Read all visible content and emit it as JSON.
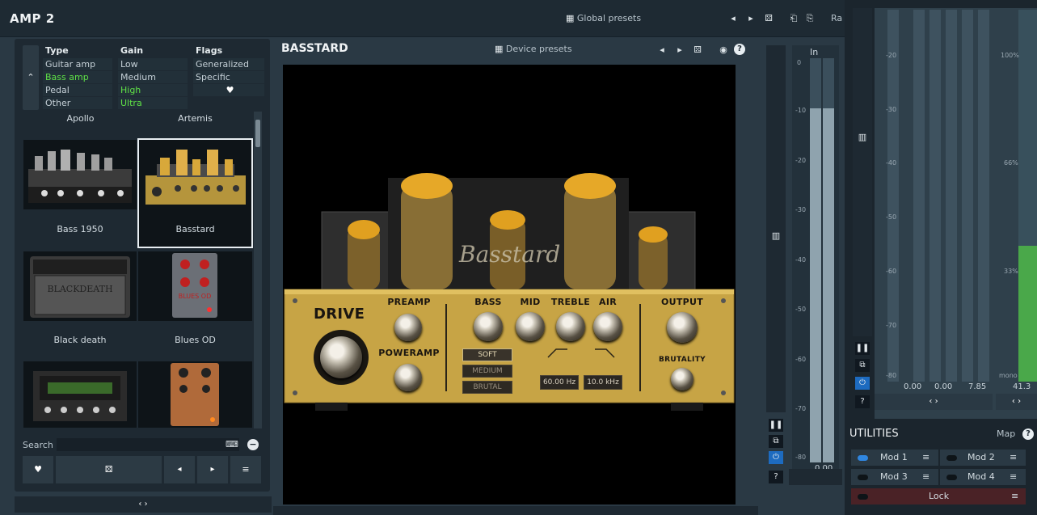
{
  "app": {
    "title": "AMP 2"
  },
  "topbar": {
    "global_presets": "Global presets",
    "ra": "Ra"
  },
  "browser": {
    "headers": {
      "type": "Type",
      "gain": "Gain",
      "flags": "Flags"
    },
    "type": [
      "Guitar amp",
      "Bass amp",
      "Pedal",
      "Other"
    ],
    "gain": [
      "Low",
      "Medium",
      "High",
      "Ultra"
    ],
    "flags": [
      "Generalized",
      "Specific"
    ],
    "top_labels": [
      "Apollo",
      "Artemis"
    ],
    "cards": [
      "Bass 1950",
      "Basstard",
      "Black death",
      "Blues OD",
      "",
      ""
    ],
    "search_label": "Search"
  },
  "device": {
    "title": "BASSTARD",
    "presets": "Device presets"
  },
  "amp": {
    "brand": "Basstard",
    "drive": "DRIVE",
    "preamp": "PREAMP",
    "poweramp": "POWERAMP",
    "bass": "BASS",
    "mid": "MID",
    "treble": "TREBLE",
    "air": "AIR",
    "output": "OUTPUT",
    "brutality": "BRUTALITY",
    "modes": [
      "SOFT",
      "MEDIUM",
      "BRUTAL"
    ],
    "freq_low": "60.00 Hz",
    "freq_high": "10.0 kHz"
  },
  "meter_in": {
    "label": "In",
    "value": "0.00",
    "scale": [
      "0",
      "-10",
      "-20",
      "-30",
      "-40",
      "-50",
      "-60",
      "-70",
      "-80"
    ]
  },
  "right_meter": {
    "scale": [
      "-20",
      "-30",
      "-40",
      "-50",
      "-60",
      "-70",
      "-80"
    ],
    "pct": [
      "100%",
      "66%",
      "33%"
    ],
    "values": [
      "0.00",
      "0.00",
      "7.85",
      "41.3"
    ],
    "mono": "mono"
  },
  "utilities": {
    "title": "UTILITIES",
    "map": "Map",
    "mods": [
      "Mod 1",
      "Mod 2",
      "Mod 3",
      "Mod 4"
    ],
    "lock": "Lock"
  },
  "colors": {
    "accent_green": "#5ee046",
    "accent_blue": "#2f86e0",
    "gold": "#c7a445"
  }
}
